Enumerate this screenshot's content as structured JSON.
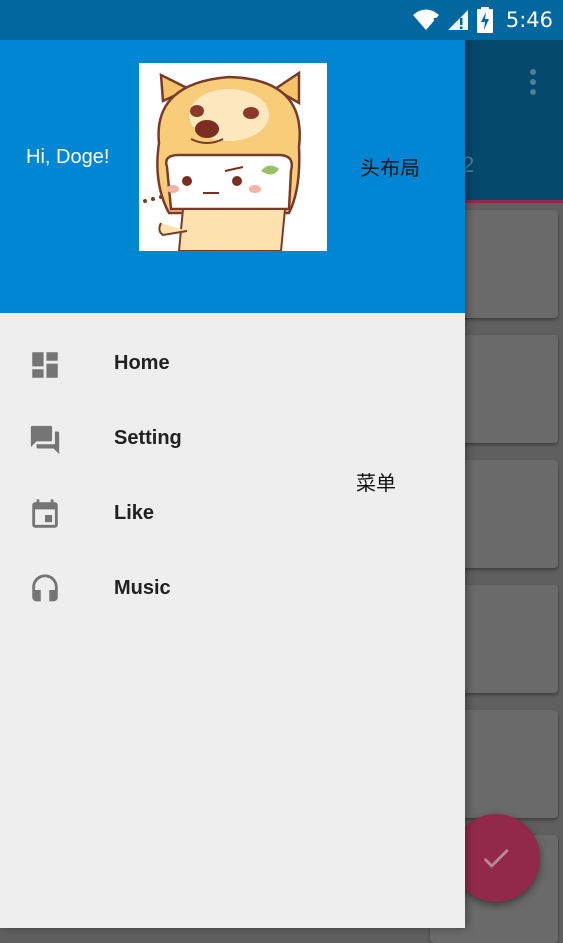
{
  "status_bar": {
    "time": "5:46"
  },
  "background_app": {
    "tab_number": "2"
  },
  "drawer": {
    "header": {
      "greeting": "Hi, Doge!"
    },
    "menu": [
      {
        "label": "Home",
        "icon": "dashboard-icon"
      },
      {
        "label": "Setting",
        "icon": "forum-icon"
      },
      {
        "label": "Like",
        "icon": "event-icon"
      },
      {
        "label": "Music",
        "icon": "headset-icon"
      }
    ]
  },
  "annotations": {
    "header_layout": "头布局",
    "menu": "菜单"
  },
  "colors": {
    "header": "#0086d2",
    "status_bar": "#00689f",
    "drawer_bg": "#eeeeee",
    "fab": "#93294a"
  }
}
